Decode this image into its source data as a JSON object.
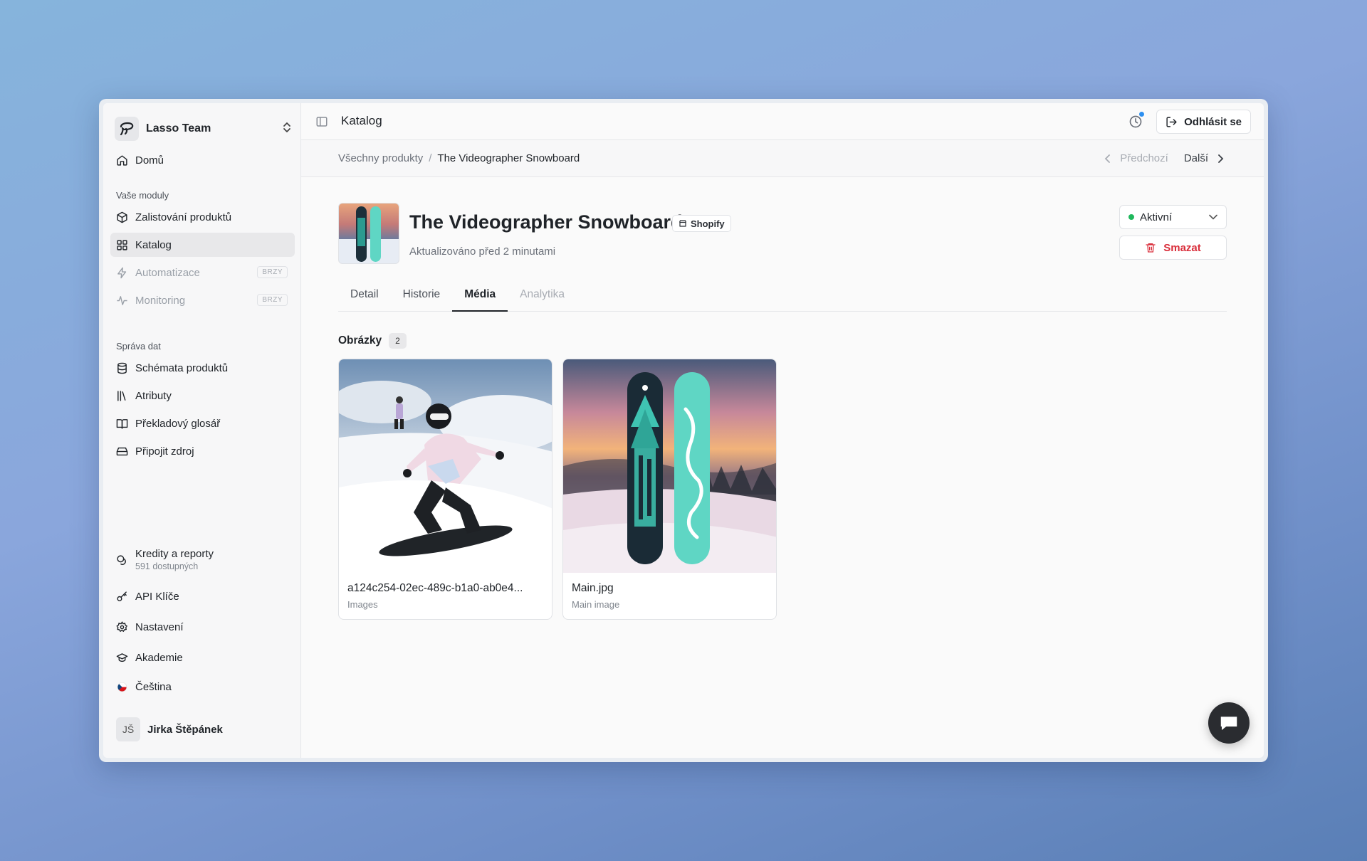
{
  "sidebar": {
    "team_name": "Lasso Team",
    "home": "Domů",
    "modules_label": "Vaše moduly",
    "modules": [
      {
        "label": "Zalistování produktů",
        "icon": "box-icon"
      },
      {
        "label": "Katalog",
        "icon": "grid-icon"
      },
      {
        "label": "Automatizace",
        "icon": "bolt-icon",
        "badge": "BRZY"
      },
      {
        "label": "Monitoring",
        "icon": "pulse-icon",
        "badge": "BRZY"
      }
    ],
    "data_label": "Správa dat",
    "data_items": [
      {
        "label": "Schémata produktů",
        "icon": "database-icon"
      },
      {
        "label": "Atributy",
        "icon": "library-icon"
      },
      {
        "label": "Překladový glosář",
        "icon": "book-icon"
      },
      {
        "label": "Připojit zdroj",
        "icon": "drive-icon"
      }
    ],
    "credits": {
      "label": "Kredity a reporty",
      "sub": "591 dostupných"
    },
    "api_keys": "API Klíče",
    "settings": "Nastavení",
    "academy": "Akademie",
    "language": "Čeština",
    "user": {
      "initials": "JŠ",
      "name": "Jirka Štěpánek"
    }
  },
  "topbar": {
    "title": "Katalog",
    "logout": "Odhlásit se"
  },
  "breadcrumb": {
    "root": "Všechny produkty",
    "separator": "/",
    "current": "The Videographer Snowboard",
    "prev": "Předchozí",
    "next": "Další"
  },
  "product": {
    "title": "The Videographer Snowboard",
    "source": "Shopify",
    "updated": "Aktualizováno před 2 minutami",
    "status": "Aktivní",
    "delete": "Smazat"
  },
  "tabs": [
    {
      "label": "Detail",
      "state": "normal"
    },
    {
      "label": "Historie",
      "state": "normal"
    },
    {
      "label": "Média",
      "state": "active"
    },
    {
      "label": "Analytika",
      "state": "disabled"
    }
  ],
  "images": {
    "title": "Obrázky",
    "count": "2",
    "items": [
      {
        "name": "a124c254-02ec-489c-b1a0-ab0e4...",
        "type": "Images"
      },
      {
        "name": "Main.jpg",
        "type": "Main image"
      }
    ]
  },
  "colors": {
    "accent_status": "#1fb85c",
    "danger": "#d92d3a",
    "notification_dot": "#2d8ff0",
    "snowboard_teal": "#5fd6c4"
  }
}
